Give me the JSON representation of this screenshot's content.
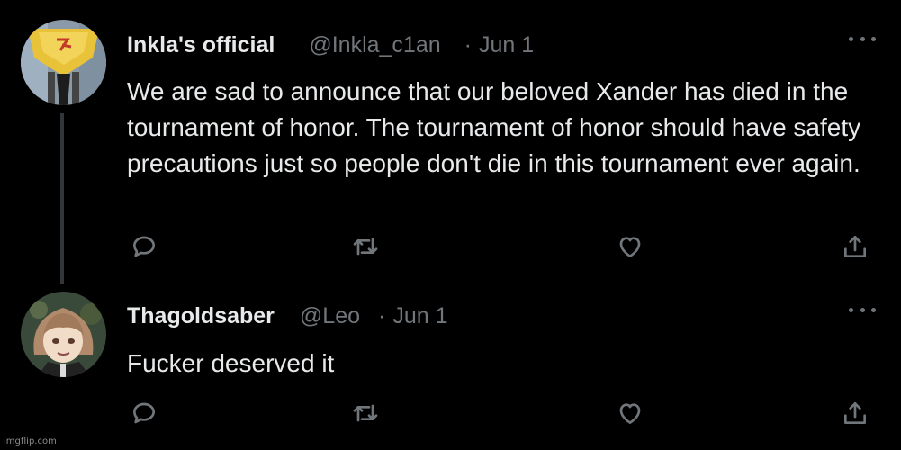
{
  "thread": {
    "tweets": [
      {
        "display_name": "Inkla's official",
        "handle": "@Inkla_c1an",
        "separator": "·",
        "date": "Jun 1",
        "text": "We are sad to announce that our beloved Xander has died in the tournament of honor. The tournament of honor should have safety precautions just so people don't die in this tournament ever again.",
        "avatar_icon": "banner-avatar-icon"
      },
      {
        "display_name": "Thagoldsaber",
        "handle": "@Leo",
        "separator": "·",
        "date": "Jun 1",
        "text": "Fucker deserved it",
        "avatar_icon": "anime-character-avatar-icon"
      }
    ],
    "action_icons": [
      "reply-icon",
      "retweet-icon",
      "like-icon",
      "share-icon"
    ]
  },
  "watermark": "imgflip.com",
  "colors": {
    "background": "#000000",
    "text_primary": "#e7e9ea",
    "text_secondary": "#71767b",
    "thread_line": "#333639"
  }
}
